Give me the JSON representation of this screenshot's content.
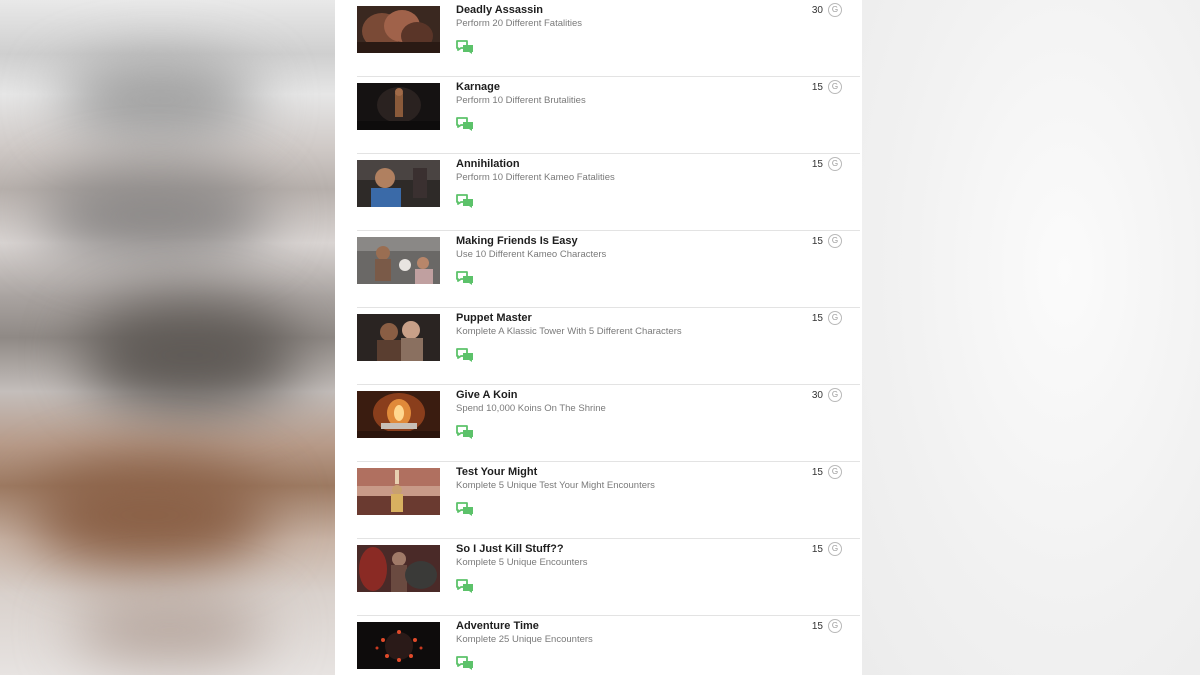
{
  "achievements": [
    {
      "title": "Deadly Assassin",
      "description": "Perform 20 Different Fatalities",
      "score": "30",
      "thumb": "thumbnail-deadly-assassin-icon"
    },
    {
      "title": "Karnage",
      "description": "Perform 10 Different Brutalities",
      "score": "15",
      "thumb": "thumbnail-karnage-icon"
    },
    {
      "title": "Annihilation",
      "description": "Perform 10 Different Kameo Fatalities",
      "score": "15",
      "thumb": "thumbnail-annihilation-icon"
    },
    {
      "title": "Making Friends Is Easy",
      "description": "Use 10 Different Kameo Characters",
      "score": "15",
      "thumb": "thumbnail-making-friends-icon"
    },
    {
      "title": "Puppet Master",
      "description": "Komplete A Klassic Tower With 5 Different Characters",
      "score": "15",
      "thumb": "thumbnail-puppet-master-icon"
    },
    {
      "title": "Give A Koin",
      "description": "Spend 10,000 Koins On The Shrine",
      "score": "30",
      "thumb": "thumbnail-give-a-koin-icon"
    },
    {
      "title": "Test Your Might",
      "description": "Komplete 5 Unique Test Your Might Encounters",
      "score": "15",
      "thumb": "thumbnail-test-your-might-icon"
    },
    {
      "title": "So I Just Kill Stuff??",
      "description": "Komplete 5 Unique Encounters",
      "score": "15",
      "thumb": "thumbnail-kill-stuff-icon"
    },
    {
      "title": "Adventure Time",
      "description": "Komplete 25 Unique Encounters",
      "score": "15",
      "thumb": "thumbnail-adventure-time-icon"
    }
  ],
  "gamerscore_symbol": "G",
  "colors": {
    "comment_icon": "#5cc26a",
    "divider": "#e3e3e3",
    "title_text": "#1e1e1e",
    "description_text": "#7a7a7a"
  },
  "icons": {
    "comment": "comment-bubbles-icon",
    "gamerscore": "gamerscore-g-icon"
  }
}
